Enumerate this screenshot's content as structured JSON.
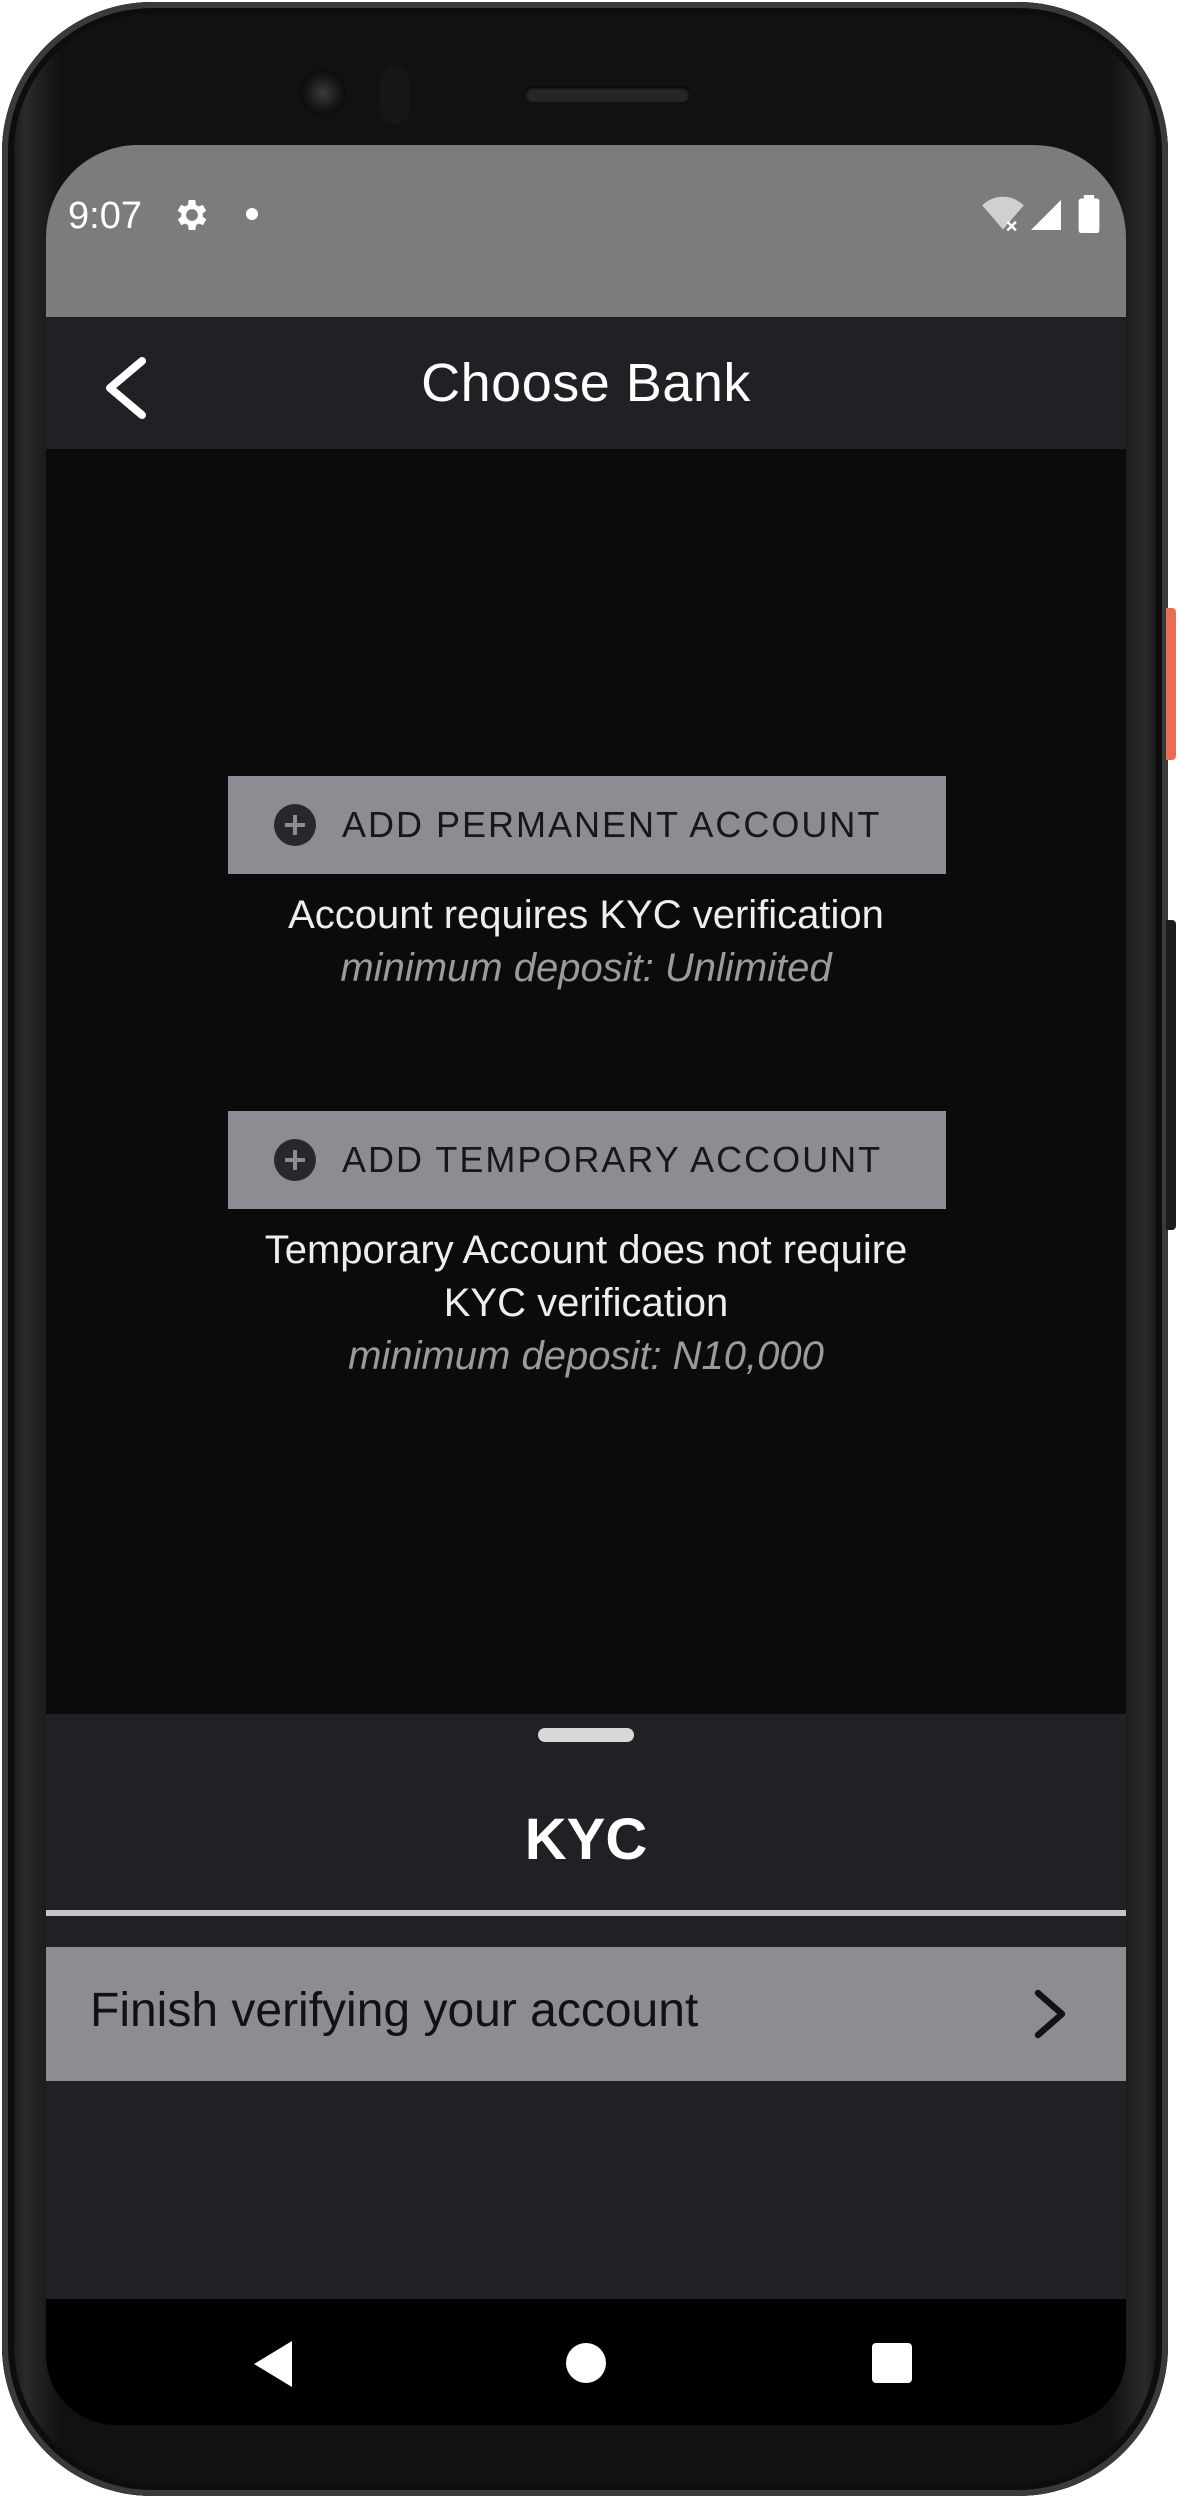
{
  "status_bar": {
    "time": "9:07",
    "icons": [
      "gear-icon",
      "notification-dot-icon",
      "wifi-icon",
      "signal-icon",
      "battery-icon"
    ]
  },
  "app_bar": {
    "title": "Choose Bank",
    "back_icon": "chevron-left-icon"
  },
  "permanent": {
    "button_label": "ADD PERMANENT ACCOUNT",
    "icon": "plus-circle-icon",
    "description": "Account requires KYC verification",
    "minimum_deposit": "minimum deposit: Unlimited"
  },
  "temporary": {
    "button_label": "ADD TEMPORARY ACCOUNT",
    "icon": "plus-circle-icon",
    "description_line1": "Temporary Account does not require",
    "description_line2": "KYC verification",
    "minimum_deposit": "minimum deposit: N10,000"
  },
  "kyc_sheet": {
    "title": "KYC",
    "row_label": "Finish verifying your account",
    "row_icon": "chevron-right-icon"
  },
  "nav_bar": {
    "icons": [
      "back-triangle-icon",
      "home-circle-icon",
      "recents-square-icon"
    ]
  },
  "colors": {
    "status_bar": "#7c7c7c",
    "app_bar": "#202124",
    "background": "#0b0b0c",
    "button": "#8b8d92",
    "side_button_accent": "#e96d55"
  }
}
